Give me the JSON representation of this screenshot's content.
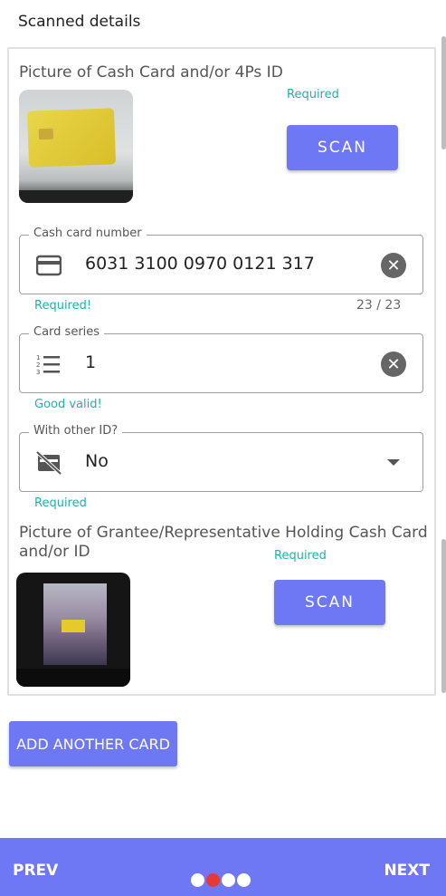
{
  "header": {
    "title": "Scanned details"
  },
  "section1": {
    "title": "Picture of Cash Card and/or 4Ps ID",
    "required": "Required",
    "scan_label": "SCAN"
  },
  "cash_card": {
    "label": "Cash card number",
    "value": "6031 3100 0970 0121 317",
    "helper": "Required!",
    "counter": "23 / 23",
    "icon": "credit-card-icon"
  },
  "card_series": {
    "label": "Card series",
    "value": "1",
    "helper": "Good valid!",
    "icon": "numbered-list-icon"
  },
  "other_id": {
    "label": "With other ID?",
    "value": "No",
    "helper": "Required",
    "icon": "no-id-card-icon"
  },
  "section2": {
    "title": "Picture of Grantee/Representative Holding Cash Card and/or ID",
    "required": "Required",
    "scan_label": "SCAN"
  },
  "add_card_label": "ADD ANOTHER CARD",
  "footer": {
    "prev_label": "PREV",
    "next_label": "NEXT",
    "step_count": 4,
    "active_step": 2
  },
  "colors": {
    "accent": "#6e78f5",
    "valid": "#20b2aa",
    "active_dot": "#e53935"
  }
}
